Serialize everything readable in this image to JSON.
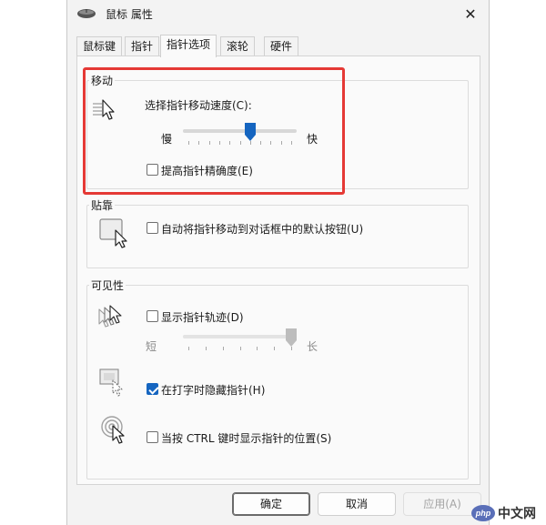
{
  "window": {
    "title": "鼠标 属性",
    "close_glyph": "✕"
  },
  "tabs": [
    {
      "label": "鼠标键",
      "active": false
    },
    {
      "label": "指针",
      "active": false
    },
    {
      "label": "指针选项",
      "active": true
    },
    {
      "label": "滚轮",
      "active": false
    },
    {
      "label": "硬件",
      "active": false
    }
  ],
  "motion": {
    "legend": "移动",
    "speed_label": "选择指针移动速度(C):",
    "slow_label": "慢",
    "fast_label": "快",
    "speed_value": 6,
    "speed_max": 10,
    "enhance_label": "提高指针精确度(E)",
    "enhance_checked": false
  },
  "snap": {
    "legend": "贴靠",
    "snap_label": "自动将指针移动到对话框中的默认按钮(U)",
    "snap_checked": false
  },
  "visibility": {
    "legend": "可见性",
    "trails_label": "显示指针轨迹(D)",
    "trails_checked": false,
    "short_label": "短",
    "long_label": "长",
    "trails_value": 1.0,
    "hide_label": "在打字时隐藏指针(H)",
    "hide_checked": true,
    "ctrl_label": "当按 CTRL 键时显示指针的位置(S)",
    "ctrl_checked": false
  },
  "buttons": {
    "ok": "确定",
    "cancel": "取消",
    "apply": "应用(A)"
  },
  "watermark": {
    "logo": "php",
    "text": "中文网"
  },
  "colors": {
    "accent": "#1565c0",
    "highlight_border": "#e53935"
  }
}
